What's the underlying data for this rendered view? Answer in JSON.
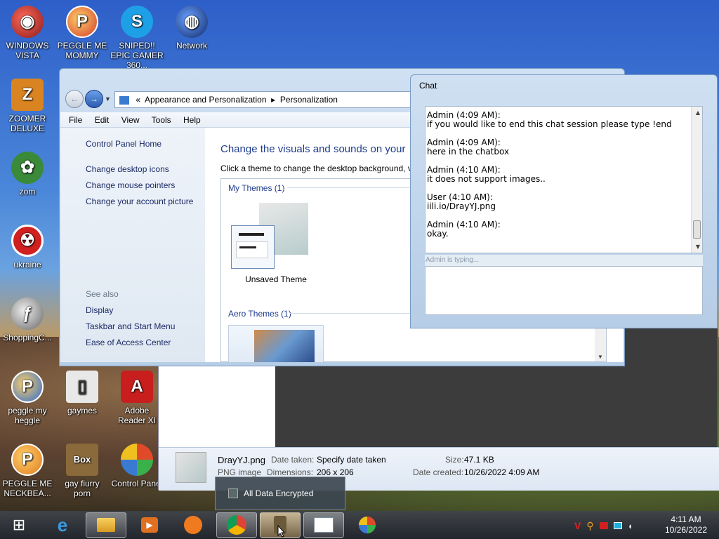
{
  "desktop_icons": [
    {
      "label": "WINDOWS VISTA",
      "icon": "vista-icon",
      "color": "#b03030"
    },
    {
      "label": "PEGGLE ME MOMMY",
      "icon": "peggle-icon",
      "color": "#d23c2a"
    },
    {
      "label": "SNIPED!! EPIC GAMER 360...",
      "icon": "skype-icon",
      "color": "#1ea0e6"
    },
    {
      "label": "Network",
      "icon": "network-icon",
      "color": "#2a4ea8"
    },
    {
      "label": "ZOOMER DELUXE",
      "icon": "zoomer-icon",
      "color": "#d98420"
    },
    {
      "label": "zom",
      "icon": "plant-icon",
      "color": "#3a8a3a"
    },
    {
      "label": "ukraine",
      "icon": "radiation-icon",
      "color": "#d02020"
    },
    {
      "label": "ShoppingC...",
      "icon": "flash-icon",
      "color": "#6a6a6a"
    },
    {
      "label": "peggle my heggle",
      "icon": "peggle-icon",
      "color": "#2a6ad0"
    },
    {
      "label": "gaymes",
      "icon": "gaymes-icon",
      "color": "#c8c8c8"
    },
    {
      "label": "Adobe Reader XI",
      "icon": "adobe-icon",
      "color": "#c81e1e"
    },
    {
      "label": "PEGGLE ME NECKBEA...",
      "icon": "peggle-icon",
      "color": "#e07a20"
    },
    {
      "label": "gay fiurry porn",
      "icon": "dog-icon",
      "color": "#8a6a3a"
    },
    {
      "label": "Control Panel",
      "icon": "control-panel-icon",
      "color": "#3a7ad0"
    }
  ],
  "cp": {
    "breadcrumb": [
      "Appearance and Personalization",
      "Personalization"
    ],
    "menu": [
      "File",
      "Edit",
      "View",
      "Tools",
      "Help"
    ],
    "sidebar_home": "Control Panel Home",
    "sidebar_links": [
      "Change desktop icons",
      "Change mouse pointers",
      "Change your account picture"
    ],
    "see_also_label": "See also",
    "see_also": [
      "Display",
      "Taskbar and Start Menu",
      "Ease of Access Center"
    ],
    "heading": "Change the visuals and sounds on your",
    "subtext": "Click a theme to change the desktop background, v",
    "my_themes": "My Themes (1)",
    "unsaved_theme": "Unsaved Theme",
    "aero_themes": "Aero Themes (1)"
  },
  "chat": {
    "title": "Chat",
    "messages": [
      {
        "header": "Admin (4:09 AM):",
        "text": "if you would like to end this chat session please type !end"
      },
      {
        "header": "Admin (4:09 AM):",
        "text": "here in the chatbox"
      },
      {
        "header": "Admin (4:10 AM):",
        "text": "it does not support images.."
      },
      {
        "header": "User (4:10 AM):",
        "text": "iili.io/DrayYJ.png"
      },
      {
        "header": "Admin (4:10 AM):",
        "text": "okay."
      }
    ],
    "typing": "Admin is typing..."
  },
  "file_details": {
    "name": "DrayYJ.png",
    "type": "PNG image",
    "date_taken_label": "Date taken:",
    "date_taken": "Specify date taken",
    "dimensions_label": "Dimensions:",
    "dimensions": "206 x 206",
    "size_label": "Size:",
    "size": "47.1 KB",
    "created_label": "Date created:",
    "created": "10/26/2022 4:09 AM"
  },
  "popup": {
    "label": "All Data Encrypted"
  },
  "clock": {
    "time": "4:11 AM",
    "date": "10/26/2022"
  }
}
